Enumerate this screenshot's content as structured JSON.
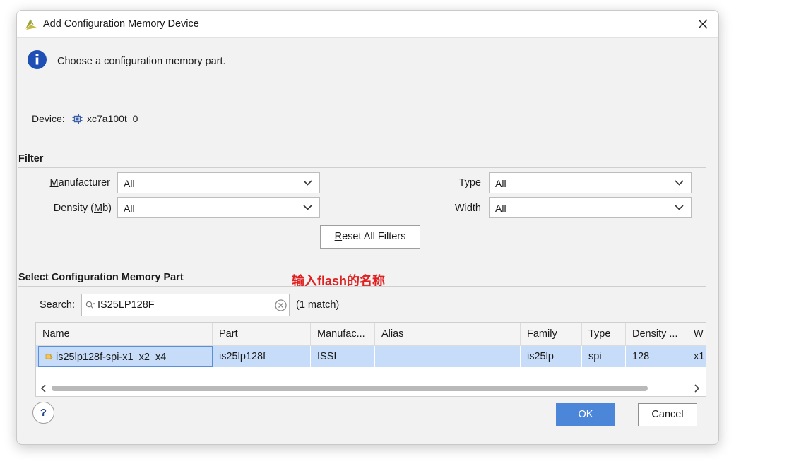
{
  "window": {
    "title": "Add Configuration Memory Device"
  },
  "info": {
    "message": "Choose a configuration memory part."
  },
  "device": {
    "label": "Device:",
    "value": "xc7a100t_0"
  },
  "filter": {
    "section_title": "Filter",
    "manufacturer": {
      "label_pre": "",
      "label_key": "M",
      "label_post": "anufacturer",
      "value": "All"
    },
    "density": {
      "label_pre": "Density (",
      "label_key": "M",
      "label_post": "b)",
      "value": "All"
    },
    "type": {
      "label": "Type",
      "value": "All"
    },
    "width": {
      "label": "Width",
      "value": "All"
    },
    "reset_button": {
      "label_key": "R",
      "label_post": "eset All Filters"
    }
  },
  "select_part": {
    "section_title": "Select Configuration Memory Part",
    "annotation": "输入flash的名称",
    "search": {
      "label_key": "S",
      "label_post": "earch:",
      "value": "IS25LP128F",
      "match_count": "(1 match)"
    }
  },
  "table": {
    "columns": [
      "Name",
      "Part",
      "Manufac...",
      "Alias",
      "Family",
      "Type",
      "Density ...",
      "W"
    ],
    "rows": [
      {
        "name": "is25lp128f-spi-x1_x2_x4",
        "part": "is25lp128f",
        "manufacturer": "ISSI",
        "alias": "",
        "family": "is25lp",
        "type": "spi",
        "density": "128",
        "width": "x1"
      }
    ]
  },
  "footer": {
    "help": "?",
    "ok": "OK",
    "cancel": "Cancel"
  },
  "colors": {
    "accent": "#4b86d8",
    "selection": "#c7dcf8",
    "annotation": "#e02020",
    "info_icon": "#1f4fb5"
  }
}
